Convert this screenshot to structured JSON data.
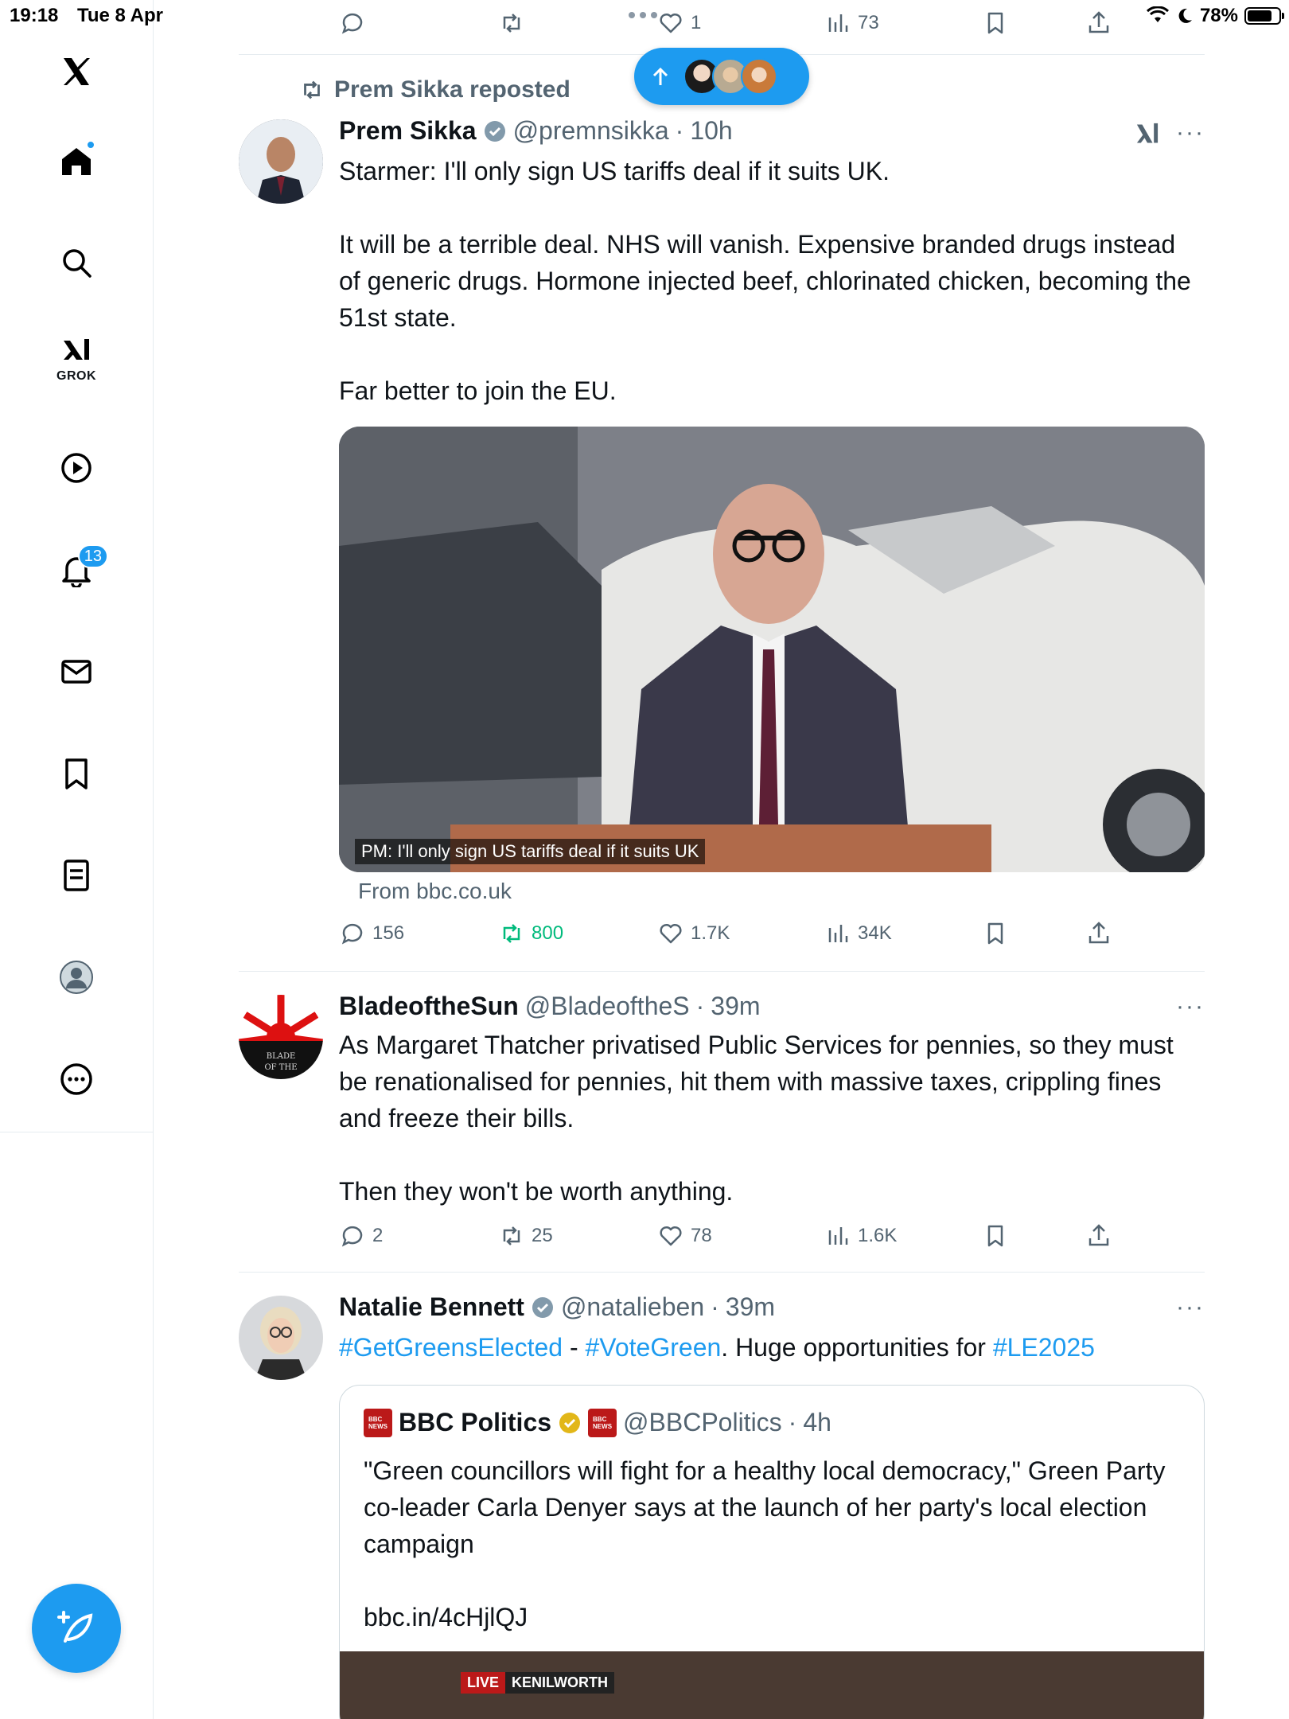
{
  "status_bar": {
    "time": "19:18",
    "date": "Tue 8 Apr",
    "battery": "78%"
  },
  "sidebar": {
    "grok_label": "GROK",
    "notifications_count": "13"
  },
  "top_actions": {
    "likes": "1",
    "views": "73"
  },
  "new_posts": {
    "icon": "arrow-up-icon"
  },
  "posts": [
    {
      "repost_label": "Prem Sikka reposted",
      "name": "Prem Sikka",
      "handle": "@premnsikka",
      "time": "10h",
      "text": "Starmer: I'll only sign US tariffs deal if it suits UK.\n\nIt will be a terrible deal. NHS will vanish. Expensive branded drugs instead of generic drugs. Hormone injected beef, chlorinated chicken, becoming the 51st state.\n\nFar better to join the EU.",
      "media_caption": "PM: I'll only sign US tariffs deal if it suits UK",
      "source": "From bbc.co.uk",
      "replies": "156",
      "reposts": "800",
      "likes": "1.7K",
      "views": "34K"
    },
    {
      "name": "BladeoftheSun",
      "handle": "@BladeoftheS",
      "time": "39m",
      "text": "As Margaret Thatcher privatised Public Services for pennies, so they must be renationalised for pennies, hit them with massive taxes, crippling fines and freeze their bills.\n\nThen they won't be worth anything.",
      "replies": "2",
      "reposts": "25",
      "likes": "78",
      "views": "1.6K"
    },
    {
      "name": "Natalie Bennett",
      "handle": "@natalieben",
      "time": "39m",
      "text_parts": [
        "#GetGreensElected",
        " - ",
        "#VoteGreen",
        ". Huge opportunities for ",
        "#LE2025"
      ],
      "quote": {
        "name": "BBC Politics",
        "handle": "@BBCPolitics",
        "time": "4h",
        "text": "\"Green councillors will fight for a healthy local democracy,\" Green Party co-leader Carla Denyer says at the launch of her party's local election campaign\n\nbbc.in/4cHjlQJ",
        "live_label": "LIVE",
        "location_label": "KENILWORTH",
        "logo_text": "BBC NEWS"
      }
    }
  ],
  "colors": {
    "accent": "#1d9bf0",
    "repost_green": "#00ba7c",
    "muted": "#536471",
    "bbc_red": "#bb1919"
  }
}
